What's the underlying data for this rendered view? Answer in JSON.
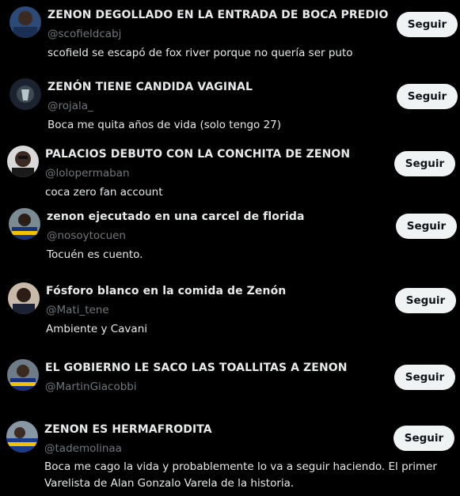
{
  "follow_label": "Seguir",
  "accounts": [
    {
      "name": "ZENON DEGOLLADO EN LA ENTRADA DE BOCA PREDIO",
      "handle": "@scofieldcabj",
      "bio": "scofield se escapó de fox river porque no quería ser puto"
    },
    {
      "name": "ZENÓN TIENE CANDIDA VAGINAL",
      "handle": "@rojala_",
      "bio": "Boca me quita años de vida (solo tengo 27)"
    },
    {
      "name": "PALACIOS DEBUTO CON LA CONCHITA DE ZENON",
      "handle": "@lolopermaban",
      "bio": "coca zero fan account"
    },
    {
      "name": "zenon ejecutado en una carcel de florida",
      "handle": "@nosoytocuen",
      "bio": "Tocuén es cuento."
    },
    {
      "name": "Fósforo blanco en la comida de Zenón",
      "handle": "@Mati_tene",
      "bio": "Ambiente y Cavani"
    },
    {
      "name": "EL GOBIERNO LE SACO LAS TOALLITAS A ZENON",
      "handle": "@MartinGiacobbi",
      "bio": ""
    },
    {
      "name": "ZENON ES HERMAFRODITA",
      "handle": "@tademolinaa",
      "bio": "Boca me cago la vida y probablemente lo va a seguir haciendo. El primer Varelista de Alan Gonzalo Varela de la historia."
    }
  ]
}
